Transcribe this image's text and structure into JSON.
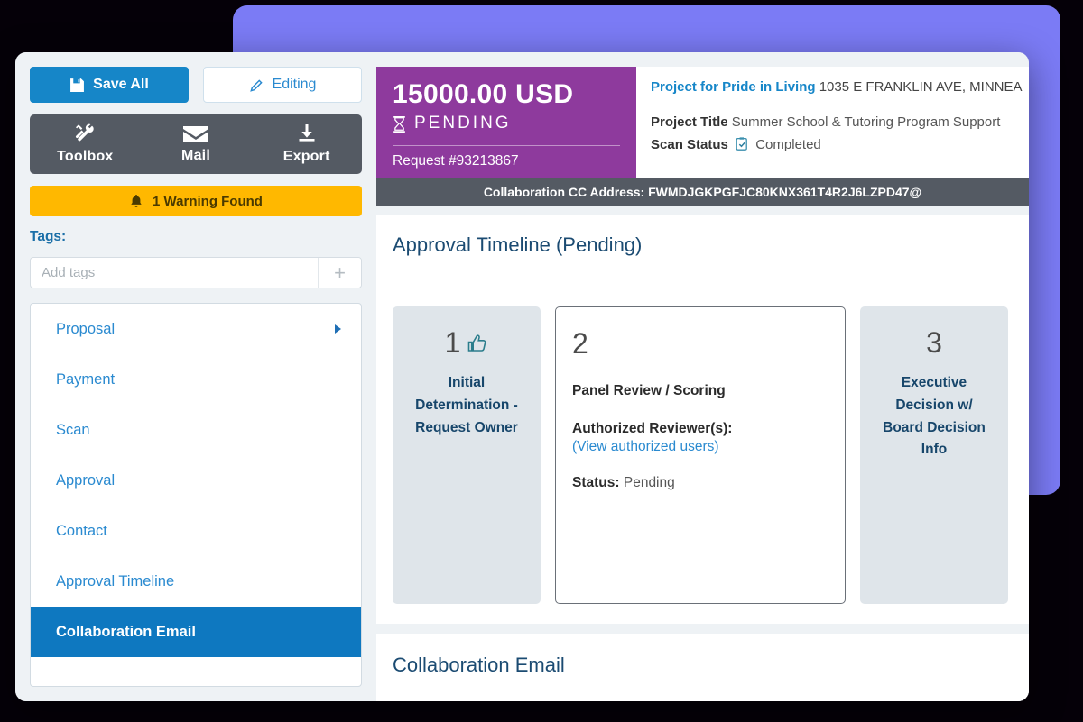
{
  "sidebar": {
    "actions": [
      {
        "label": "Save All",
        "icon": "save-icon"
      },
      {
        "label": "Editing",
        "icon": "pencil-icon"
      }
    ],
    "tools": [
      {
        "label": "Toolbox",
        "icon": "tools-icon"
      },
      {
        "label": "Mail",
        "icon": "envelope-icon"
      },
      {
        "label": "Export",
        "icon": "download-icon"
      }
    ],
    "warning": {
      "label": "1 Warning Found",
      "icon": "bell-icon",
      "color": "#ffb800"
    },
    "tags": {
      "label": "Tags:",
      "placeholder": "Add tags",
      "value": "",
      "add_label": "+"
    },
    "nav": [
      {
        "label": "Proposal",
        "active": false,
        "caret": true
      },
      {
        "label": "Payment",
        "active": false,
        "caret": false
      },
      {
        "label": "Scan",
        "active": false,
        "caret": false
      },
      {
        "label": "Approval",
        "active": false,
        "caret": false
      },
      {
        "label": "Contact",
        "active": false,
        "caret": false
      },
      {
        "label": "Approval Timeline",
        "active": false,
        "caret": false
      },
      {
        "label": "Collaboration Email",
        "active": true,
        "caret": false
      }
    ]
  },
  "header": {
    "amount": "15000.00  USD",
    "status": "PENDING",
    "status_icon": "hourglass-icon",
    "request": "Request #93213867",
    "accent_color": "#8e3a9d",
    "project_org": "Project for Pride in Living",
    "project_address": "1035 E FRANKLIN AVE,  MINNEA",
    "project_title_label": "Project Title",
    "project_title_value": "Summer School & Tutoring Program Support",
    "scan_status_label": "Scan Status",
    "scan_status_icon": "clipboard-check-icon",
    "scan_status_value": "Completed",
    "cc_label": "Collaboration CC Address:",
    "cc_value": "FWMDJGKPGFJC80KNX361T4R2J6LZPD47@"
  },
  "timeline": {
    "title": "Approval Timeline (Pending)",
    "steps": [
      {
        "number": "1",
        "icon": "thumbs-up-icon",
        "name": "Initial Determination - Request Owner",
        "state": "muted"
      },
      {
        "number": "2",
        "icon": "",
        "name": "Panel Review / Scoring",
        "reviewers_label": "Authorized Reviewer(s):",
        "reviewers_link": "(View authorized users)",
        "status_label": "Status:",
        "status_value": "Pending",
        "state": "active"
      },
      {
        "number": "3",
        "icon": "",
        "name": "Executive Decision w/ Board Decision Info",
        "state": "muted"
      }
    ]
  },
  "bottom": {
    "title": "Collaboration Email"
  }
}
